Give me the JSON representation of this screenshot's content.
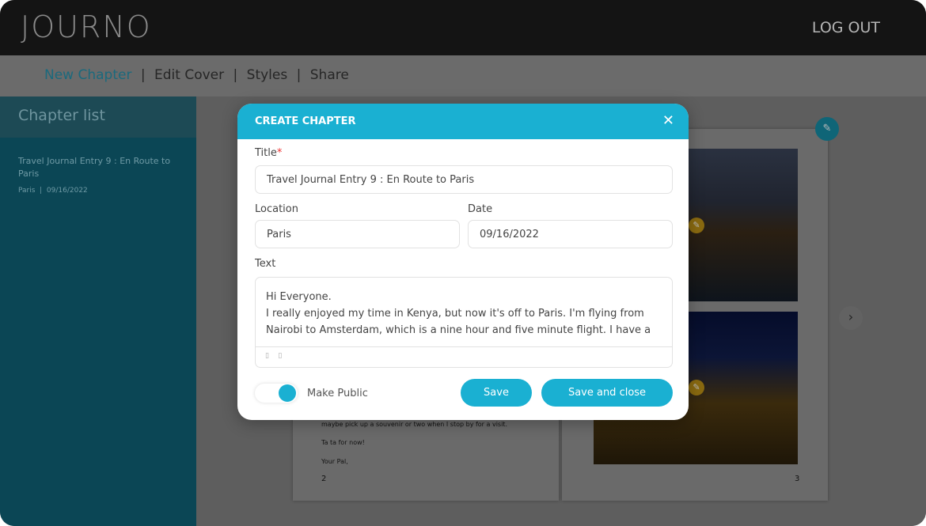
{
  "header": {
    "logo": "JOURNO",
    "logout": "LOG OUT"
  },
  "nav": {
    "items": [
      "New Chapter",
      "Edit Cover",
      "Styles",
      "Share"
    ],
    "separator": "|"
  },
  "sidebar": {
    "title": "Chapter list",
    "items": [
      {
        "title": "Travel Journal Entry 9 : En Route to Paris",
        "meta": "Paris  |  09/16/2022"
      }
    ]
  },
  "book": {
    "left_page": {
      "lines": [
        "maybe pick up a souvenir or two when I stop by for a visit.",
        "Ta ta for now!",
        "Your Pal,"
      ],
      "page_number": "2"
    },
    "right_page": {
      "page_number": "3"
    }
  },
  "modal": {
    "title": "CREATE CHAPTER",
    "title_label": "Title",
    "required_mark": "*",
    "title_value": "Travel Journal Entry 9 : En Route to Paris",
    "location_label": "Location",
    "location_value": "Paris",
    "date_label": "Date",
    "date_value": "09/16/2022",
    "text_label": "Text",
    "text_lines": [
      "Hi Everyone.",
      "I really enjoyed my time in Kenya, but now it's off to Paris. I'm flying from",
      "Nairobi to Amsterdam, which is a nine hour and five minute flight. I have a"
    ],
    "make_public_label": "Make Public",
    "make_public": true,
    "save": "Save",
    "save_close": "Save and close"
  },
  "colors": {
    "accent": "#1ab0d2",
    "sidebar": "#117d97",
    "header": "#1a1a1a"
  }
}
